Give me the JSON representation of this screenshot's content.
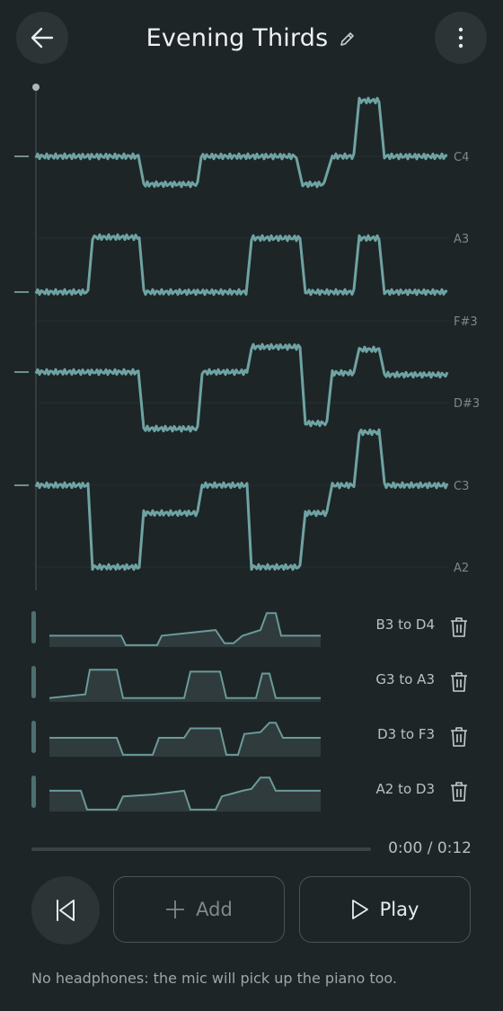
{
  "header": {
    "title": "Evening Thirds",
    "back_icon": "arrow-left-icon",
    "edit_icon": "pencil-icon",
    "menu_icon": "more-vertical-icon"
  },
  "pitch_graph": {
    "note_labels": [
      "C4",
      "A3",
      "F#3",
      "D#3",
      "C3",
      "A2"
    ],
    "line_color": "#6fa3a3"
  },
  "tracks": [
    {
      "label": "B3 to D4",
      "delete_icon": "trash-icon"
    },
    {
      "label": "G3 to A3",
      "delete_icon": "trash-icon"
    },
    {
      "label": "D3 to F3",
      "delete_icon": "trash-icon"
    },
    {
      "label": "A2 to D3",
      "delete_icon": "trash-icon"
    }
  ],
  "playback": {
    "time": "0:00 / 0:12",
    "progress": 0,
    "rewind_icon": "skip-back-icon",
    "add_label": "Add",
    "add_icon": "plus-icon",
    "play_label": "Play",
    "play_icon": "play-icon"
  },
  "hint": "No headphones: the mic will pick up the piano too."
}
